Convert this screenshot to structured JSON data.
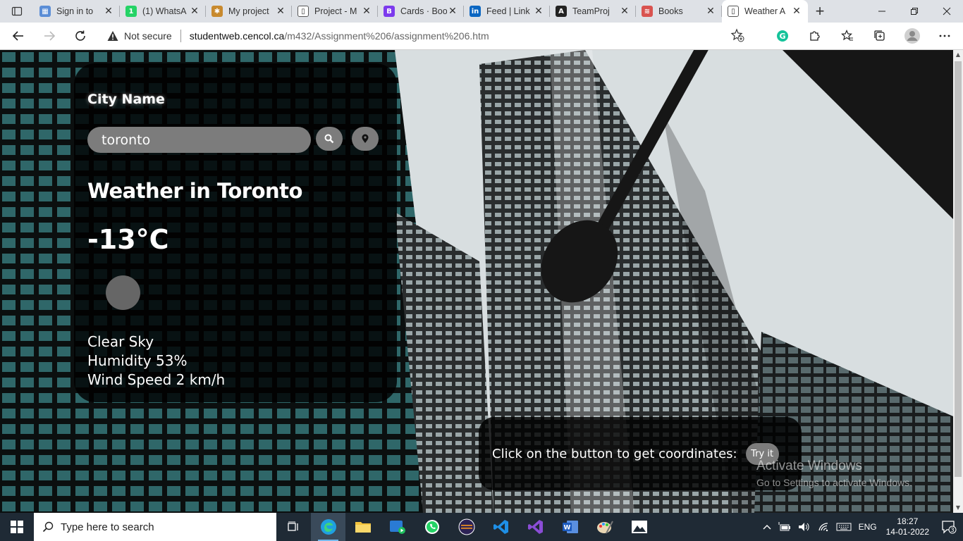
{
  "browser": {
    "tabs": [
      {
        "title": "Sign in to",
        "fav_color": "#5a8dd6",
        "fav_glyph": "▦"
      },
      {
        "title": "(1) WhatsA",
        "fav_color": "#25d366",
        "fav_glyph": "1"
      },
      {
        "title": "My project",
        "fav_color": "#c88a2e",
        "fav_glyph": "✱"
      },
      {
        "title": "Project - M",
        "fav_color": "#ffffff",
        "fav_glyph": "▯"
      },
      {
        "title": "Cards · Boo",
        "fav_color": "#7c3aed",
        "fav_glyph": "B"
      },
      {
        "title": "Feed | Link",
        "fav_color": "#0a66c2",
        "fav_glyph": "in"
      },
      {
        "title": "TeamProj",
        "fav_color": "#222222",
        "fav_glyph": "A"
      },
      {
        "title": "Books",
        "fav_color": "#d9534f",
        "fav_glyph": "≋"
      },
      {
        "title": "Weather A",
        "fav_color": "#ffffff",
        "fav_glyph": "▯",
        "active": true
      }
    ],
    "not_secure": "Not secure",
    "url_host": "studentweb.cencol.ca",
    "url_path": "/m432/Assignment%206/assignment%206.htm"
  },
  "weather": {
    "city_label": "City Name",
    "search_value": "toronto",
    "title": "Weather in Toronto",
    "temp": "-13°C",
    "description": "Clear Sky",
    "humidity": "Humidity 53%",
    "wind": "Wind Speed 2 km/h"
  },
  "coords": {
    "prompt": "Click on the button to get coordinates:",
    "button": "Try it"
  },
  "watermark": {
    "line1": "Activate Windows",
    "line2": "Go to Settings to activate Windows."
  },
  "taskbar": {
    "search_placeholder": "Type here to search",
    "lang": "ENG",
    "time": "18:27",
    "date": "14-01-2022",
    "notif_count": "3"
  }
}
